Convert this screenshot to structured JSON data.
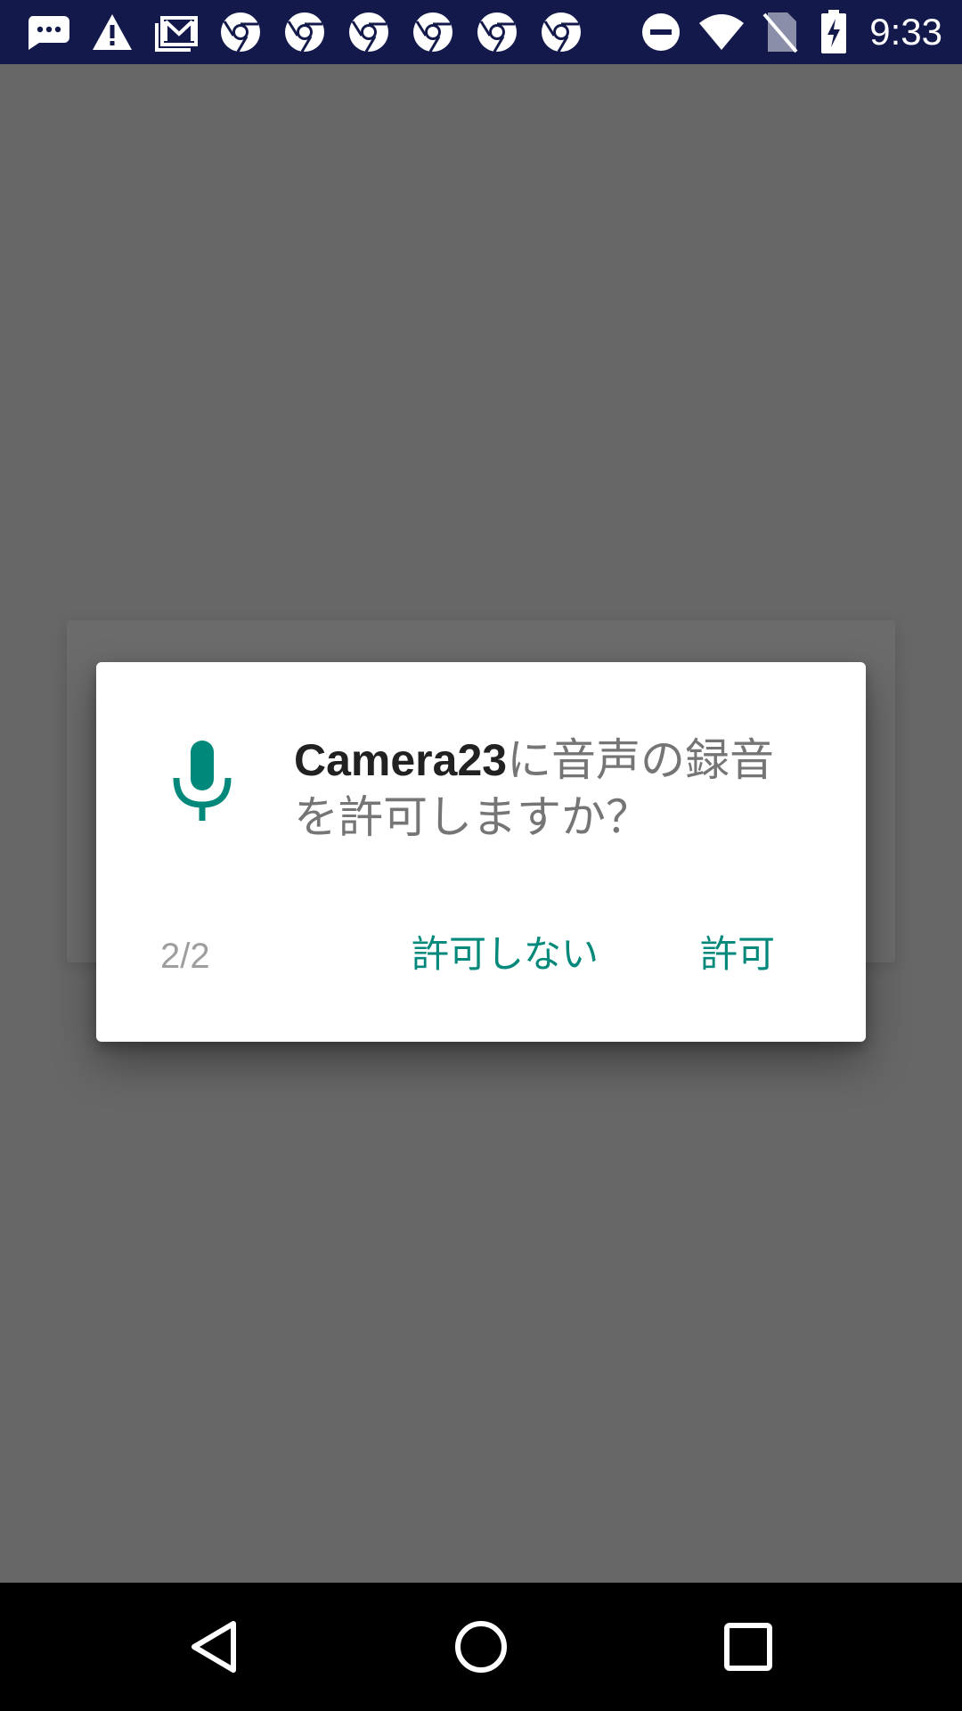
{
  "status_bar": {
    "time": "9:33",
    "notification_icons": [
      "chat-bubble-icon",
      "warning-icon",
      "gmail-icon",
      "chrome-icon",
      "chrome-icon",
      "chrome-icon",
      "chrome-icon",
      "chrome-icon",
      "chrome-icon"
    ],
    "system_icons": [
      "do-not-disturb-icon",
      "wifi-icon",
      "no-sim-icon",
      "battery-charging-icon"
    ],
    "background_color": "#131a4b"
  },
  "dialog": {
    "icon": "microphone-icon",
    "app_name": "Camera23",
    "message_rest": "に音声の録音を許可しますか？",
    "counter": "2/2",
    "deny_label": "許可しない",
    "allow_label": "許可",
    "accent_color": "#00897b"
  },
  "nav_bar": {
    "buttons": [
      "back-icon",
      "home-icon",
      "recents-icon"
    ]
  }
}
